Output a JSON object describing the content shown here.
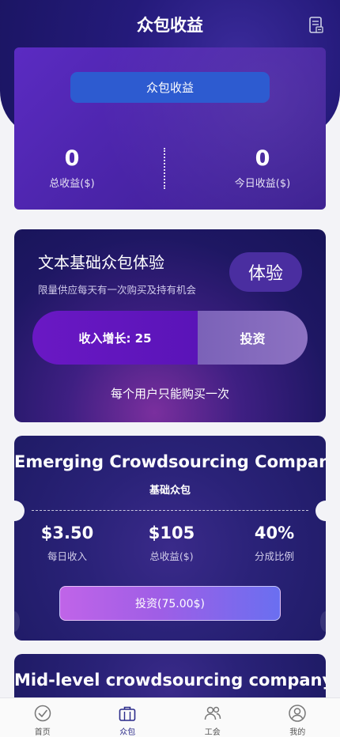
{
  "header": {
    "title": "众包收益"
  },
  "earnings": {
    "button_label": "众包收益",
    "total": {
      "value": "0",
      "label": "总收益($)"
    },
    "today": {
      "value": "0",
      "label": "今日收益($)"
    }
  },
  "experience": {
    "title": "文本基础众包体验",
    "subtitle": "限量供应每天有一次购买及持有机会",
    "badge": "体验",
    "growth_label": "收入增长: 25",
    "invest_label": "投资",
    "note": "每个用户只能购买一次"
  },
  "companies": [
    {
      "title": "Emerging Crowdsourcing Companies",
      "tag": "基础众包",
      "daily_income": {
        "value": "$3.50",
        "label": "每日收入"
      },
      "total_income": {
        "value": "$105",
        "label": "总收益($)"
      },
      "share_ratio": {
        "value": "40%",
        "label": "分成比例"
      },
      "invest_button": "投资(75.00$)"
    },
    {
      "title": "Mid-level crowdsourcing company"
    }
  ],
  "nav": {
    "items": [
      {
        "label": "首页",
        "icon": "check-circle-icon"
      },
      {
        "label": "众包",
        "icon": "briefcase-icon"
      },
      {
        "label": "工会",
        "icon": "users-icon"
      },
      {
        "label": "我的",
        "icon": "user-circle-icon"
      }
    ],
    "active_index": 1
  },
  "colors": {
    "header": "#241a7a",
    "earn_button": "#2d5bd0",
    "accent_purple": "#6a18c4",
    "page_bg": "#f3f3f7"
  }
}
